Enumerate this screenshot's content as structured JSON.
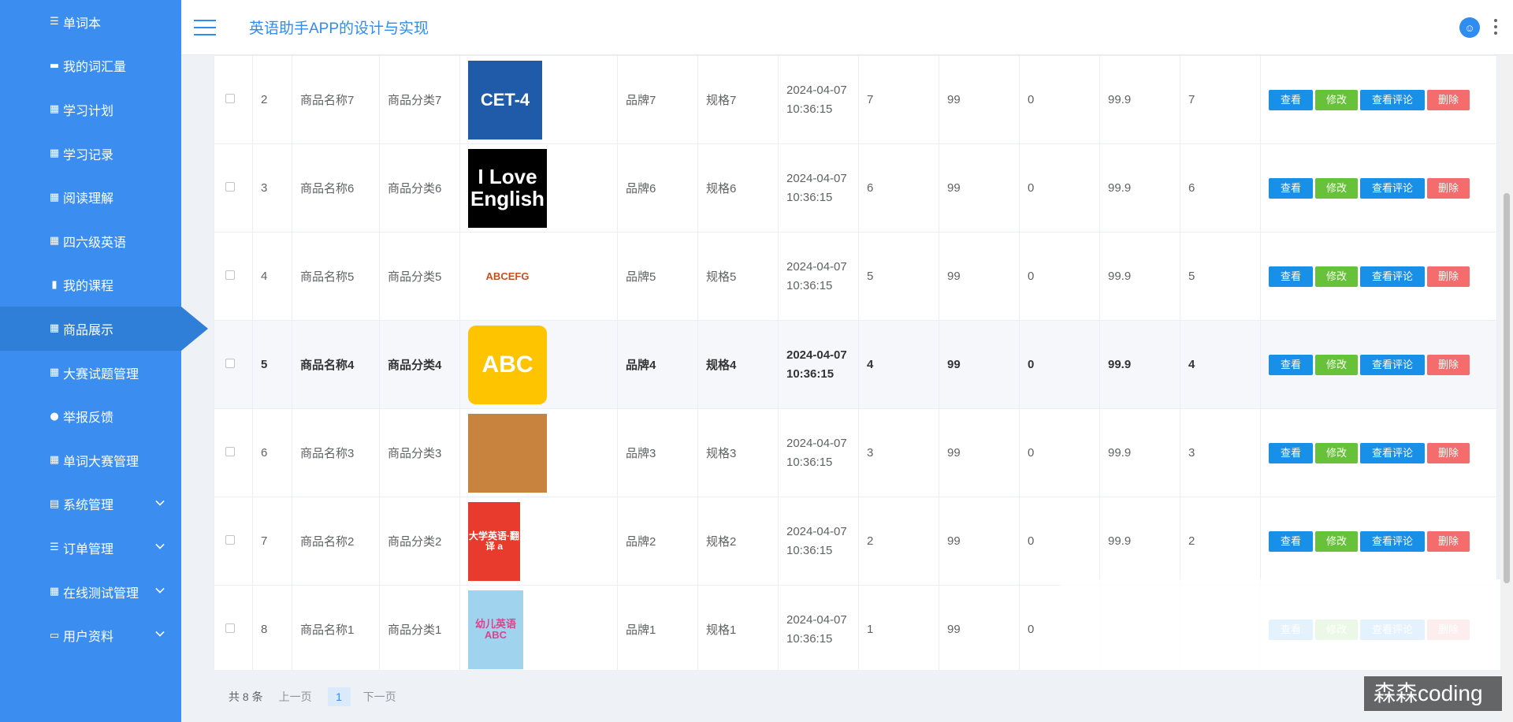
{
  "header": {
    "title": "英语助手APP的设计与实现"
  },
  "sidebar": {
    "items": [
      {
        "label": "单词本",
        "icon": "list-icon"
      },
      {
        "label": "我的词汇量",
        "icon": "card-icon"
      },
      {
        "label": "学习计划",
        "icon": "grid-icon"
      },
      {
        "label": "学习记录",
        "icon": "grid-icon"
      },
      {
        "label": "阅读理解",
        "icon": "grid-icon"
      },
      {
        "label": "四六级英语",
        "icon": "grid-icon"
      },
      {
        "label": "我的课程",
        "icon": "book-icon"
      },
      {
        "label": "商品展示",
        "icon": "grid-icon",
        "active": true
      },
      {
        "label": "大赛试题管理",
        "icon": "grid-icon"
      },
      {
        "label": "举报反馈",
        "icon": "user-icon"
      },
      {
        "label": "单词大赛管理",
        "icon": "grid-icon"
      },
      {
        "label": "系统管理",
        "icon": "doc-icon",
        "expandable": true
      },
      {
        "label": "订单管理",
        "icon": "list-icon",
        "expandable": true
      },
      {
        "label": "在线测试管理",
        "icon": "grid-icon",
        "expandable": true
      },
      {
        "label": "用户资料",
        "icon": "calendar-icon",
        "expandable": true
      }
    ]
  },
  "buttons": {
    "view": "查看",
    "edit": "修改",
    "comment": "查看评论",
    "delete": "删除"
  },
  "rows": [
    {
      "idx": "2",
      "name": "商品名称7",
      "cat": "商品分类7",
      "img": "CET-4",
      "brand": "品牌7",
      "spec": "规格7",
      "time": "2024-04-07 10:36:15",
      "c1": "7",
      "c2": "99",
      "c3": "0",
      "price": "99.9",
      "c5": "7"
    },
    {
      "idx": "3",
      "name": "商品名称6",
      "cat": "商品分类6",
      "img": "I Love English",
      "brand": "品牌6",
      "spec": "规格6",
      "time": "2024-04-07 10:36:15",
      "c1": "6",
      "c2": "99",
      "c3": "0",
      "price": "99.9",
      "c5": "6"
    },
    {
      "idx": "4",
      "name": "商品名称5",
      "cat": "商品分类5",
      "img": "ABCEFG",
      "brand": "品牌5",
      "spec": "规格5",
      "time": "2024-04-07 10:36:15",
      "c1": "5",
      "c2": "99",
      "c3": "0",
      "price": "99.9",
      "c5": "5"
    },
    {
      "idx": "5",
      "name": "商品名称4",
      "cat": "商品分类4",
      "img": "ABC",
      "brand": "品牌4",
      "spec": "规格4",
      "time": "2024-04-07 10:36:15",
      "c1": "4",
      "c2": "99",
      "c3": "0",
      "price": "99.9",
      "c5": "4"
    },
    {
      "idx": "6",
      "name": "商品名称3",
      "cat": "商品分类3",
      "img": "",
      "brand": "品牌3",
      "spec": "规格3",
      "time": "2024-04-07 10:36:15",
      "c1": "3",
      "c2": "99",
      "c3": "0",
      "price": "99.9",
      "c5": "3"
    },
    {
      "idx": "7",
      "name": "商品名称2",
      "cat": "商品分类2",
      "img": "大学英语·翻译 a",
      "brand": "品牌2",
      "spec": "规格2",
      "time": "2024-04-07 10:36:15",
      "c1": "2",
      "c2": "99",
      "c3": "0",
      "price": "99.9",
      "c5": "2"
    },
    {
      "idx": "8",
      "name": "商品名称1",
      "cat": "商品分类1",
      "img": "幼儿英语 ABC",
      "brand": "品牌1",
      "spec": "规格1",
      "time": "2024-04-07 10:36:15",
      "c1": "1",
      "c2": "99",
      "c3": "0",
      "price": "",
      "c5": ""
    }
  ],
  "pagination": {
    "total": "共 8 条",
    "prev": "上一页",
    "current": "1",
    "next": "下一页"
  },
  "watermark": "森森coding",
  "colors": {
    "sidebar": "#3b8ef0",
    "accent": "#2f8cf0",
    "view": "#1890e8",
    "edit": "#67c23a",
    "delete": "#f56c6c"
  }
}
